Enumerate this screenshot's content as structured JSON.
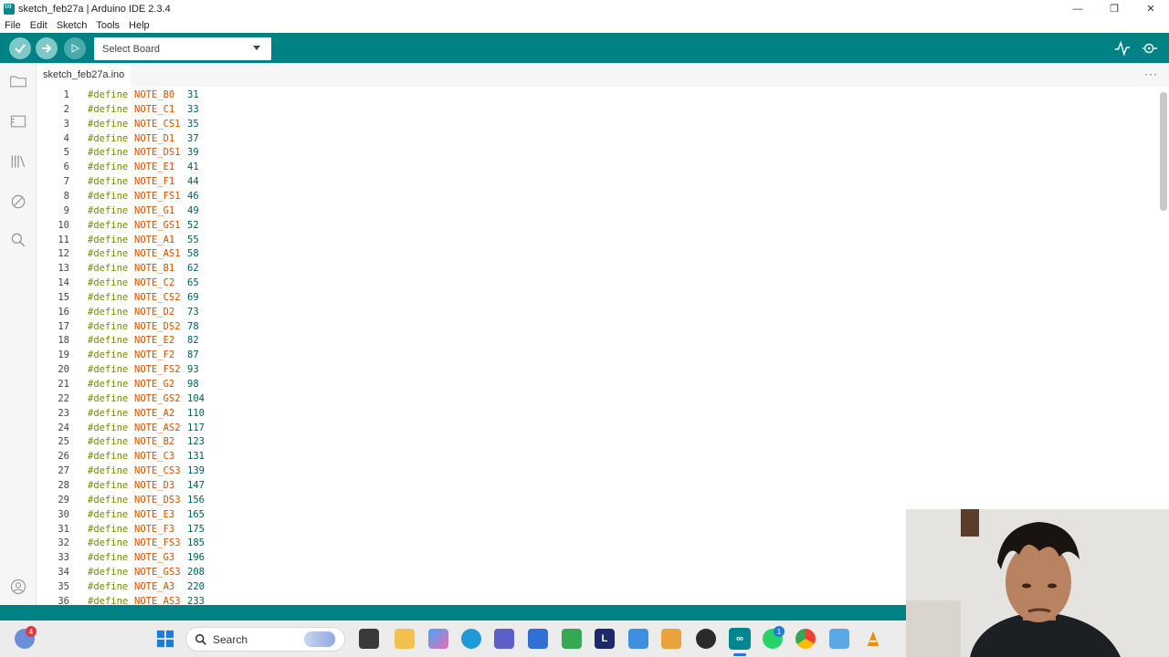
{
  "window": {
    "title": "sketch_feb27a | Arduino IDE 2.3.4",
    "controls": [
      "—",
      "❐",
      "✕"
    ]
  },
  "menu": [
    "File",
    "Edit",
    "Sketch",
    "Tools",
    "Help"
  ],
  "toolbar": {
    "verify_icon": "check-icon",
    "upload_icon": "arrow-right-icon",
    "debug_icon": "debug-icon",
    "board_select": "Select Board",
    "serial_plotter_icon": "serial-plotter-icon",
    "serial_monitor_icon": "serial-monitor-icon"
  },
  "sidebar": {
    "items": [
      "sketchbook-icon",
      "boards-manager-icon",
      "library-manager-icon",
      "debug-icon",
      "search-icon"
    ],
    "bottom": "profile-icon"
  },
  "tabs": [
    {
      "label": "sketch_feb27a.ino"
    }
  ],
  "tab_more": "···",
  "code": [
    {
      "n": "1",
      "kw": "#define",
      "name": "NOTE_B0",
      "val": "31"
    },
    {
      "n": "2",
      "kw": "#define",
      "name": "NOTE_C1",
      "val": "33"
    },
    {
      "n": "3",
      "kw": "#define",
      "name": "NOTE_CS1",
      "val": "35"
    },
    {
      "n": "4",
      "kw": "#define",
      "name": "NOTE_D1",
      "val": "37"
    },
    {
      "n": "5",
      "kw": "#define",
      "name": "NOTE_DS1",
      "val": "39"
    },
    {
      "n": "6",
      "kw": "#define",
      "name": "NOTE_E1",
      "val": "41"
    },
    {
      "n": "7",
      "kw": "#define",
      "name": "NOTE_F1",
      "val": "44"
    },
    {
      "n": "8",
      "kw": "#define",
      "name": "NOTE_FS1",
      "val": "46"
    },
    {
      "n": "9",
      "kw": "#define",
      "name": "NOTE_G1",
      "val": "49"
    },
    {
      "n": "10",
      "kw": "#define",
      "name": "NOTE_GS1",
      "val": "52"
    },
    {
      "n": "11",
      "kw": "#define",
      "name": "NOTE_A1",
      "val": "55"
    },
    {
      "n": "12",
      "kw": "#define",
      "name": "NOTE_AS1",
      "val": "58"
    },
    {
      "n": "13",
      "kw": "#define",
      "name": "NOTE_B1",
      "val": "62"
    },
    {
      "n": "14",
      "kw": "#define",
      "name": "NOTE_C2",
      "val": "65"
    },
    {
      "n": "15",
      "kw": "#define",
      "name": "NOTE_CS2",
      "val": "69"
    },
    {
      "n": "16",
      "kw": "#define",
      "name": "NOTE_D2",
      "val": "73"
    },
    {
      "n": "17",
      "kw": "#define",
      "name": "NOTE_DS2",
      "val": "78"
    },
    {
      "n": "18",
      "kw": "#define",
      "name": "NOTE_E2",
      "val": "82"
    },
    {
      "n": "19",
      "kw": "#define",
      "name": "NOTE_F2",
      "val": "87"
    },
    {
      "n": "20",
      "kw": "#define",
      "name": "NOTE_FS2",
      "val": "93"
    },
    {
      "n": "21",
      "kw": "#define",
      "name": "NOTE_G2",
      "val": "98"
    },
    {
      "n": "22",
      "kw": "#define",
      "name": "NOTE_GS2",
      "val": "104"
    },
    {
      "n": "23",
      "kw": "#define",
      "name": "NOTE_A2",
      "val": "110"
    },
    {
      "n": "24",
      "kw": "#define",
      "name": "NOTE_AS2",
      "val": "117"
    },
    {
      "n": "25",
      "kw": "#define",
      "name": "NOTE_B2",
      "val": "123"
    },
    {
      "n": "26",
      "kw": "#define",
      "name": "NOTE_C3",
      "val": "131"
    },
    {
      "n": "27",
      "kw": "#define",
      "name": "NOTE_CS3",
      "val": "139"
    },
    {
      "n": "28",
      "kw": "#define",
      "name": "NOTE_D3",
      "val": "147"
    },
    {
      "n": "29",
      "kw": "#define",
      "name": "NOTE_DS3",
      "val": "156"
    },
    {
      "n": "30",
      "kw": "#define",
      "name": "NOTE_E3",
      "val": "165"
    },
    {
      "n": "31",
      "kw": "#define",
      "name": "NOTE_F3",
      "val": "175"
    },
    {
      "n": "32",
      "kw": "#define",
      "name": "NOTE_FS3",
      "val": "185"
    },
    {
      "n": "33",
      "kw": "#define",
      "name": "NOTE_G3",
      "val": "196"
    },
    {
      "n": "34",
      "kw": "#define",
      "name": "NOTE_GS3",
      "val": "208"
    },
    {
      "n": "35",
      "kw": "#define",
      "name": "NOTE_A3",
      "val": "220"
    },
    {
      "n": "36",
      "kw": "#define",
      "name": "NOTE_AS3",
      "val": "233"
    }
  ],
  "taskbar": {
    "search_placeholder": "Search",
    "weather_badge": "4",
    "teams_badge": "1",
    "apps": [
      "windows-start-icon",
      "file-explorer-icon",
      "copilot-icon",
      "edge-icon",
      "teams-icon",
      "store-icon",
      "meet-icon",
      "L-app-icon",
      "azure-icon",
      "sublime-icon",
      "obs-icon",
      "arduino-icon",
      "whatsapp-icon",
      "chrome-icon",
      "notepad-icon",
      "vlc-icon"
    ],
    "L_label": "L"
  },
  "colors": {
    "teal": "#008184",
    "keyword": "#728e00",
    "constant": "#d35400",
    "number": "#005c5f"
  }
}
